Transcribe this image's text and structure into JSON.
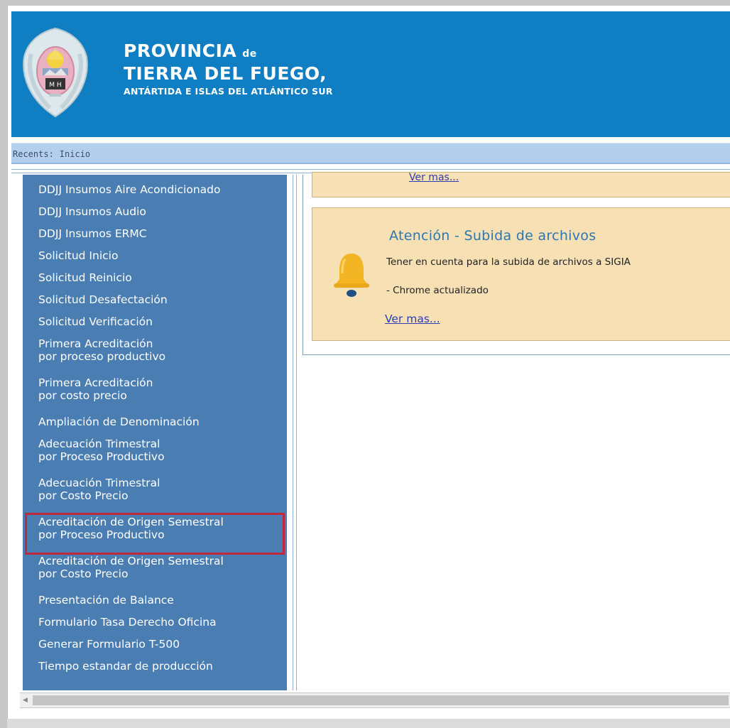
{
  "header": {
    "title_line1": "PROVINCIA",
    "title_line1_small": "de",
    "title_line2": "TIERRA DEL FUEGO,",
    "title_line3": "ANTÁRTIDA E ISLAS DEL ATLÁNTICO SUR",
    "emblem_icon": "provincial-coat-of-arms-icon",
    "background_color": "#0f7ec2"
  },
  "recents": {
    "label": "Recents:",
    "items": [
      "Inicio"
    ]
  },
  "sidebar": {
    "background_color": "#4a7eb2",
    "highlight_color": "#c0283d",
    "items": [
      {
        "label": "DDJJ Insumos Aire Acondicionado"
      },
      {
        "label": "DDJJ Insumos Audio"
      },
      {
        "label": "DDJJ Insumos ERMC"
      },
      {
        "label": "Solicitud Inicio"
      },
      {
        "label": "Solicitud Reinicio"
      },
      {
        "label": "Solicitud Desafectación"
      },
      {
        "label": "Solicitud Verificación"
      },
      {
        "label": "Primera Acreditación\npor proceso productivo"
      },
      {
        "label": "Primera Acreditación\npor costo precio"
      },
      {
        "label": "Ampliación de Denominación"
      },
      {
        "label": "Adecuación Trimestral\npor Proceso Productivo"
      },
      {
        "label": "Adecuación Trimestral\npor Costo Precio"
      },
      {
        "label": "Acreditación de Origen Semestral\npor Proceso Productivo",
        "highlighted": true
      },
      {
        "label": "Acreditación de Origen Semestral\npor Costo Precio"
      },
      {
        "label": "Presentación de Balance"
      },
      {
        "label": "Formulario Tasa Derecho Oficina"
      },
      {
        "label": "Generar Formulario T-500"
      },
      {
        "label": "Tiempo estandar de producción"
      }
    ]
  },
  "notices": {
    "previous_link": "Ver mas...",
    "main": {
      "icon": "bell-icon",
      "title": "Atención - Subida de archivos",
      "text": "Tener en cuenta para la subida de archivos a SIGIA",
      "list_item": "- Chrome actualizado",
      "link": "Ver mas...",
      "background_color": "#f6e0b4"
    }
  },
  "scrollbar": {
    "left_arrow_icon": "scroll-left-arrow-icon"
  }
}
